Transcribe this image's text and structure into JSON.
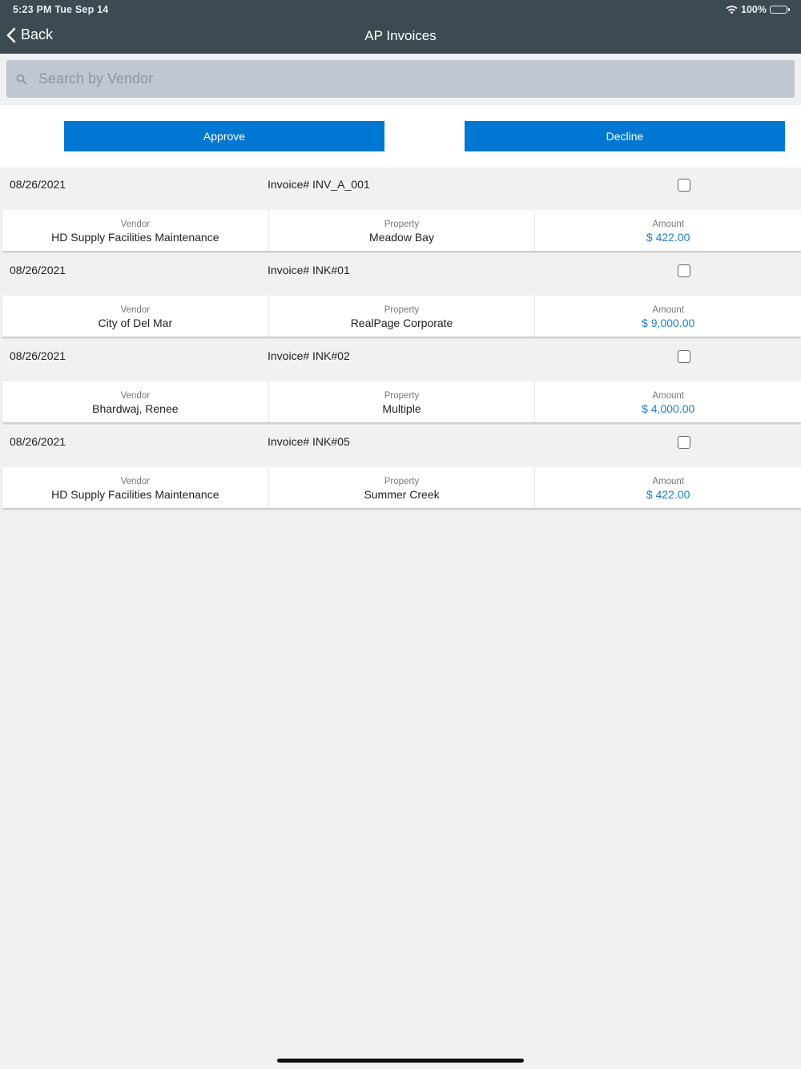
{
  "status": {
    "time": "5:23 PM   Tue Sep 14",
    "battery": "100%"
  },
  "nav": {
    "back_label": "Back",
    "title": "AP Invoices"
  },
  "search": {
    "placeholder": "Search by Vendor"
  },
  "actions": {
    "approve_label": "Approve",
    "decline_label": "Decline"
  },
  "labels": {
    "vendor": "Vendor",
    "property": "Property",
    "amount": "Amount"
  },
  "invoices": [
    {
      "date": "08/26/2021",
      "invoice": "Invoice# INV_A_001",
      "vendor": "HD Supply Facilities Maintenance",
      "property": "Meadow Bay",
      "amount": "$ 422.00"
    },
    {
      "date": "08/26/2021",
      "invoice": "Invoice# INK#01",
      "vendor": "City of Del Mar",
      "property": "RealPage Corporate",
      "amount": "$ 9,000.00"
    },
    {
      "date": "08/26/2021",
      "invoice": "Invoice# INK#02",
      "vendor": "Bhardwaj, Renee",
      "property": "Multiple",
      "amount": "$ 4,000.00"
    },
    {
      "date": "08/26/2021",
      "invoice": "Invoice# INK#05",
      "vendor": "HD Supply Facilities Maintenance",
      "property": "Summer Creek",
      "amount": "$ 422.00"
    }
  ],
  "colors": {
    "nav_bg": "#3c4a52",
    "accent": "#0077d3",
    "amount": "#1a7ec9"
  }
}
